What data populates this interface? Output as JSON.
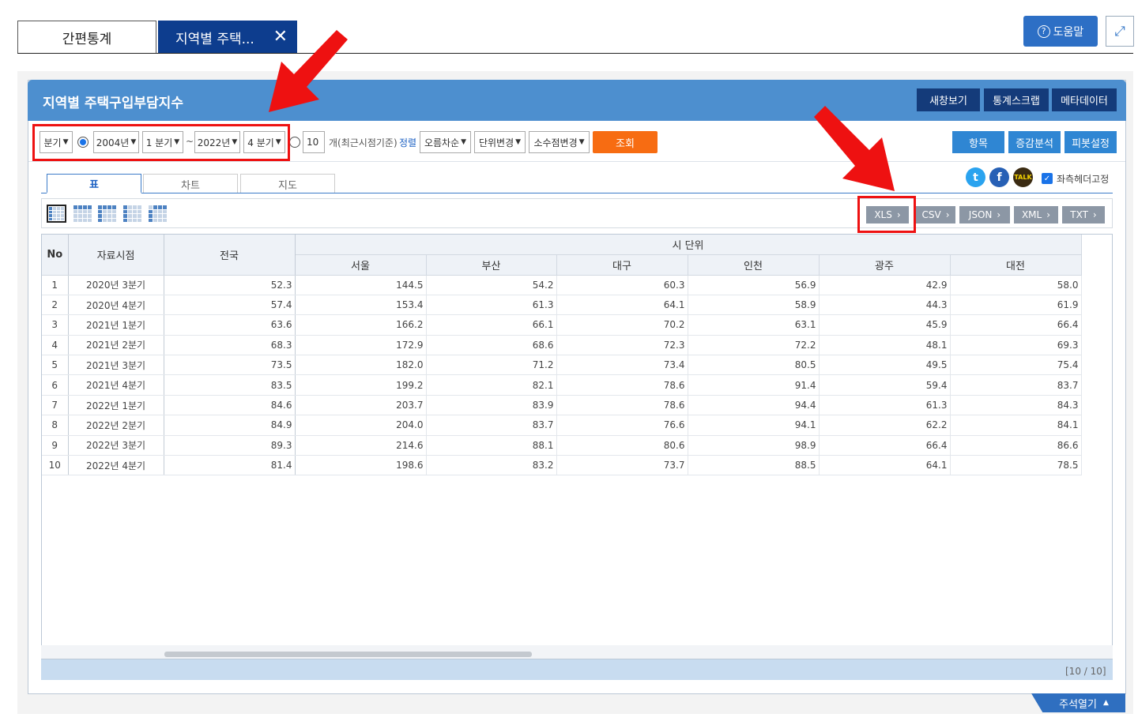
{
  "tabs": {
    "simple": "간편통계",
    "active": "지역별 주택...",
    "close_glyph": "✕"
  },
  "help": {
    "q_glyph": "?",
    "label": "도움말"
  },
  "expand_glyph": "⤢",
  "panel": {
    "title": "지역별 주택구입부담지수",
    "buttons": [
      "새창보기",
      "통계스크랩",
      "메타데이터"
    ]
  },
  "controls": {
    "period_type": "분기",
    "start_year": "2004년",
    "start_quarter": "1 분기",
    "range_sep": "~",
    "end_year": "2022년",
    "end_quarter": "4 분기",
    "recent_count": "10",
    "recent_label": "개(최근시점기준)",
    "sort_label": "정렬",
    "sort_order": "오름차순",
    "unit_change": "단위변경",
    "decimal_change": "소수점변경",
    "query_button": "조회",
    "right_buttons": [
      "항목",
      "증감분석",
      "피봇설정"
    ]
  },
  "view_tabs": [
    "표",
    "차트",
    "지도"
  ],
  "social": {
    "twitter": "t",
    "facebook": "f",
    "kakao": "TALK"
  },
  "fix_header": {
    "check": "✓",
    "label": "좌측헤더고정"
  },
  "downloads": [
    "XLS",
    "CSV",
    "JSON",
    "XML",
    "TXT"
  ],
  "download_chevron": "›",
  "table": {
    "headers": {
      "no": "No",
      "period": "자료시점",
      "national": "전국",
      "group": "시 단위",
      "cities": [
        "서울",
        "부산",
        "대구",
        "인천",
        "광주",
        "대전"
      ]
    },
    "rows": [
      {
        "no": "1",
        "period": "2020년 3분기",
        "values": [
          "52.3",
          "144.5",
          "54.2",
          "60.3",
          "56.9",
          "42.9",
          "58.0"
        ]
      },
      {
        "no": "2",
        "period": "2020년 4분기",
        "values": [
          "57.4",
          "153.4",
          "61.3",
          "64.1",
          "58.9",
          "44.3",
          "61.9"
        ]
      },
      {
        "no": "3",
        "period": "2021년 1분기",
        "values": [
          "63.6",
          "166.2",
          "66.1",
          "70.2",
          "63.1",
          "45.9",
          "66.4"
        ]
      },
      {
        "no": "4",
        "period": "2021년 2분기",
        "values": [
          "68.3",
          "172.9",
          "68.6",
          "72.3",
          "72.2",
          "48.1",
          "69.3"
        ]
      },
      {
        "no": "5",
        "period": "2021년 3분기",
        "values": [
          "73.5",
          "182.0",
          "71.2",
          "73.4",
          "80.5",
          "49.5",
          "75.4"
        ]
      },
      {
        "no": "6",
        "period": "2021년 4분기",
        "values": [
          "83.5",
          "199.2",
          "82.1",
          "78.6",
          "91.4",
          "59.4",
          "83.7"
        ]
      },
      {
        "no": "7",
        "period": "2022년 1분기",
        "values": [
          "84.6",
          "203.7",
          "83.9",
          "78.6",
          "94.4",
          "61.3",
          "84.3"
        ]
      },
      {
        "no": "8",
        "period": "2022년 2분기",
        "values": [
          "84.9",
          "204.0",
          "83.7",
          "76.6",
          "94.1",
          "62.2",
          "84.1"
        ]
      },
      {
        "no": "9",
        "period": "2022년 3분기",
        "values": [
          "89.3",
          "214.6",
          "88.1",
          "80.6",
          "98.9",
          "66.4",
          "86.6"
        ]
      },
      {
        "no": "10",
        "period": "2022년 4분기",
        "values": [
          "81.4",
          "198.6",
          "83.2",
          "73.7",
          "88.5",
          "64.1",
          "78.5"
        ]
      }
    ]
  },
  "paging": "[10 / 10]",
  "notes_button": "주석열기",
  "notes_glyph": "▲"
}
